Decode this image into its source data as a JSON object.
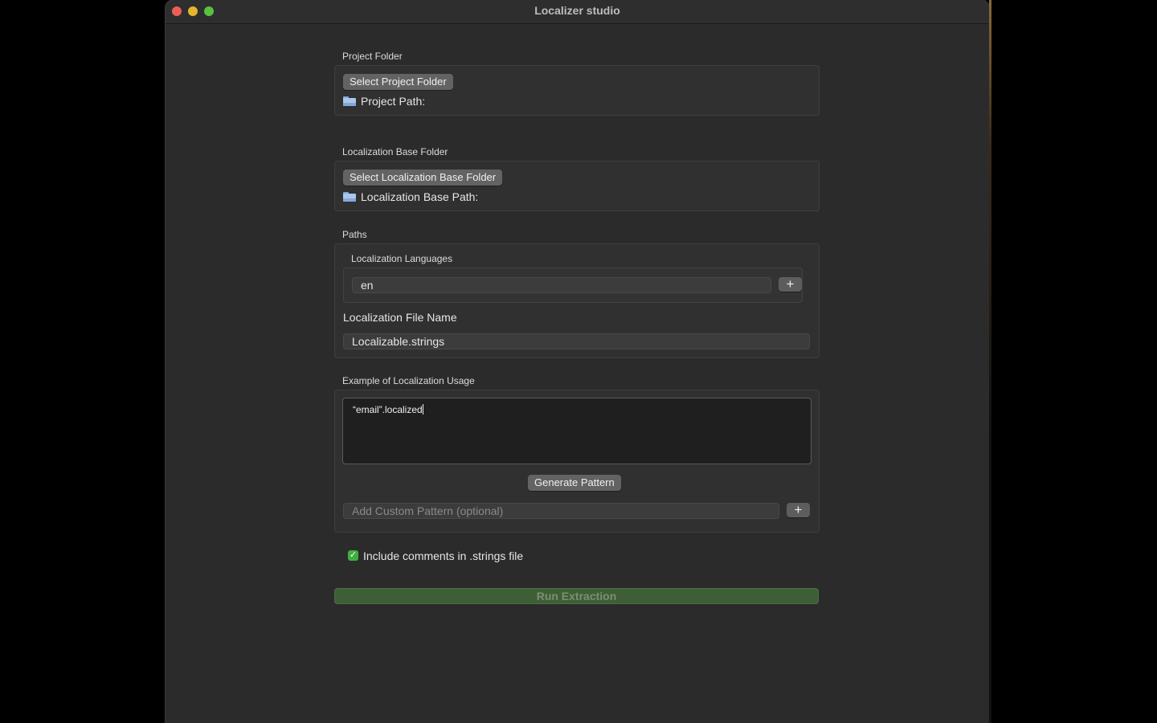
{
  "window": {
    "title": "Localizer studio"
  },
  "project_folder": {
    "section_label": "Project Folder",
    "select_button": "Select Project Folder",
    "path_label": "Project Path:"
  },
  "localization_base_folder": {
    "section_label": "Localization Base Folder",
    "select_button": "Select Localization Base Folder",
    "path_label": "Localization Base Path:"
  },
  "paths": {
    "section_label": "Paths",
    "languages_label": "Localization Languages",
    "language_value": "en",
    "add_language_label": "+",
    "file_name_label": "Localization File Name",
    "file_name_value": "Localizable.strings"
  },
  "usage_example": {
    "section_label": "Example of Localization Usage",
    "example_text": "“email”.localized",
    "generate_button": "Generate Pattern",
    "custom_pattern_placeholder": "Add Custom Pattern (optional)",
    "add_pattern_label": "+"
  },
  "options": {
    "include_comments_label": "Include comments in .strings file",
    "include_comments_checked": true
  },
  "run_button": "Run Extraction",
  "colors": {
    "window_bg": "#2b2b2b",
    "accent_green": "#3fae3f",
    "run_button_bg": "#3e5f35"
  }
}
